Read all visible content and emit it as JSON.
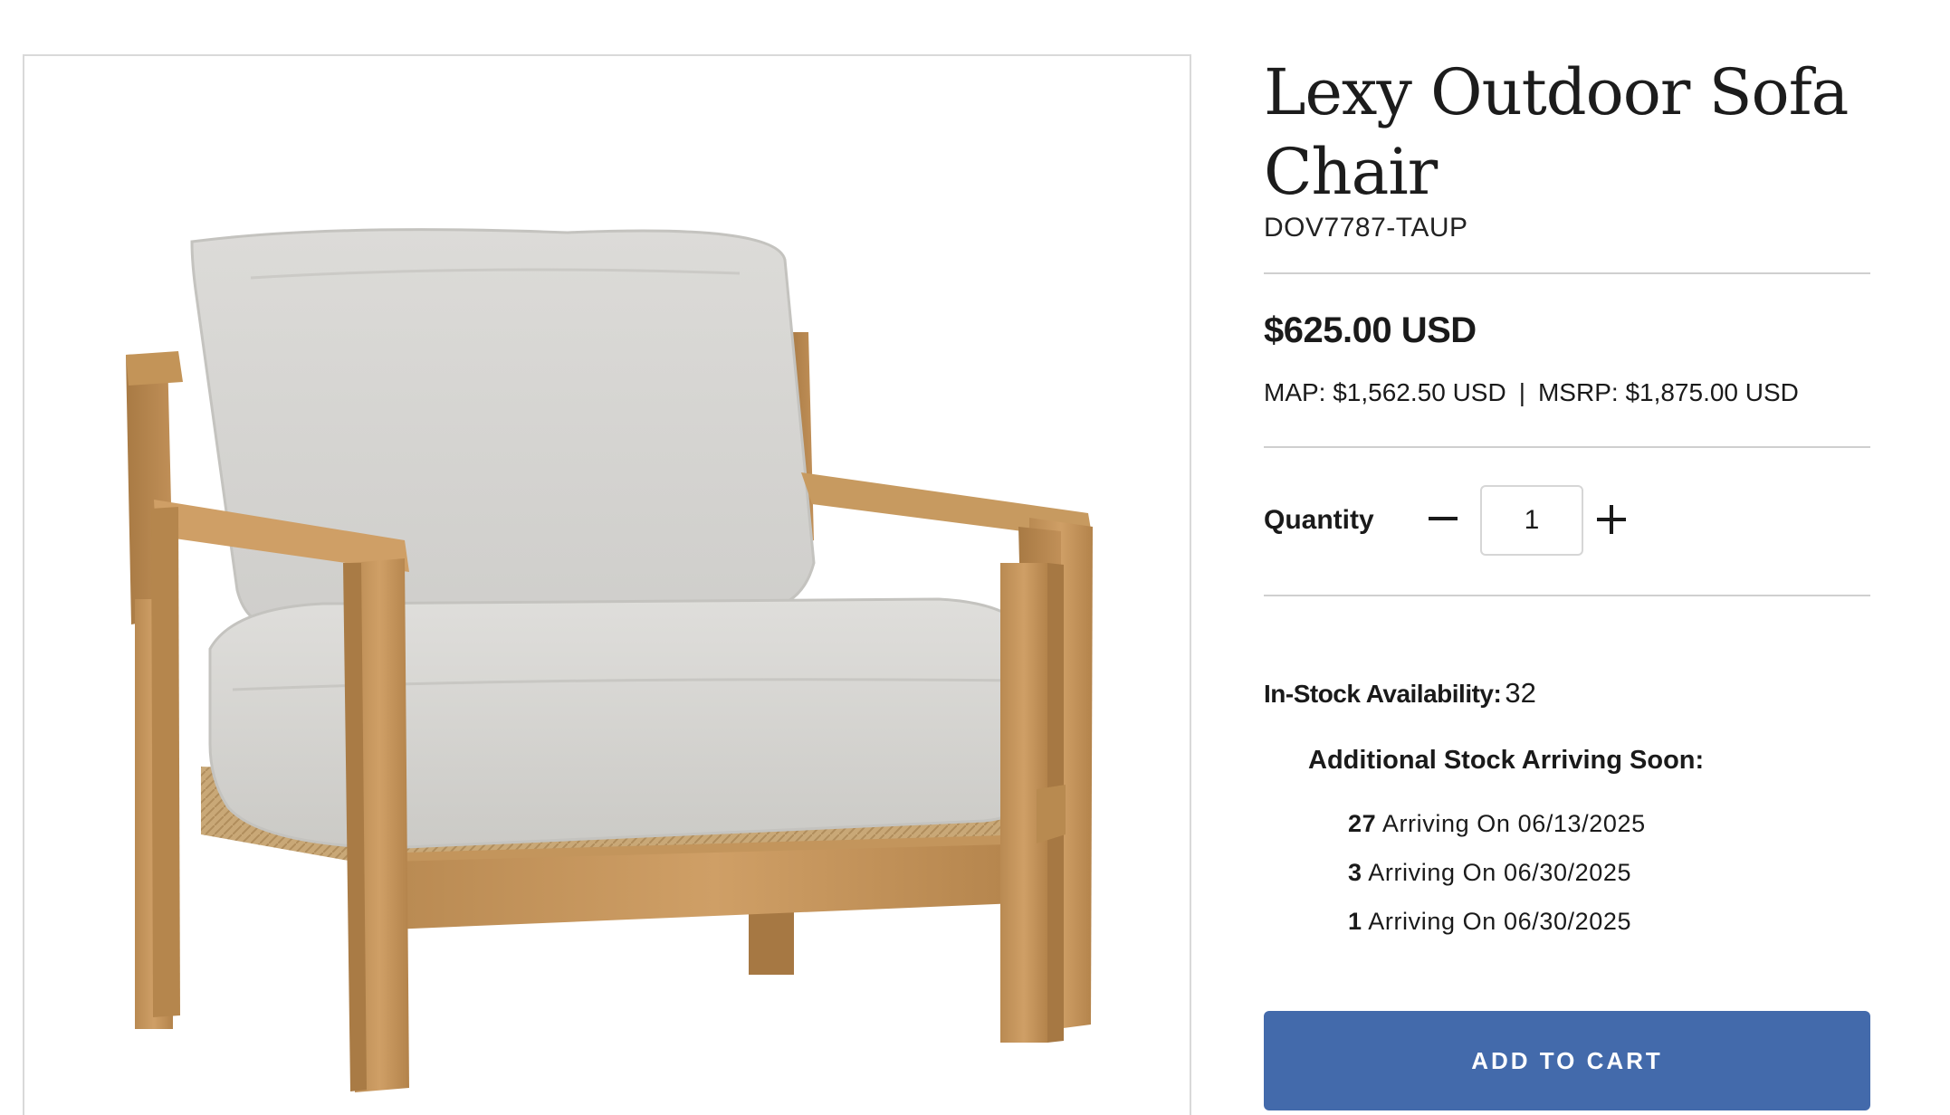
{
  "product": {
    "title": "Lexy Outdoor Sofa Chair",
    "sku": "DOV7787-TAUP",
    "price": "$625.00 USD",
    "map": "MAP: $1,562.50 USD",
    "msrp": "MSRP: $1,875.00 USD",
    "separator": "|",
    "image_subject": "teak armchair with light grey cushions"
  },
  "quantity": {
    "label": "Quantity",
    "value": "1",
    "decrement_icon": "minus-icon",
    "increment_icon": "plus-icon"
  },
  "stock": {
    "label": "In-Stock Availability:",
    "value": "32",
    "arriving_heading": "Additional Stock Arriving Soon:",
    "arrivals": [
      {
        "count": "27",
        "text": "Arriving On 06/13/2025"
      },
      {
        "count": "3",
        "text": "Arriving On 06/30/2025"
      },
      {
        "count": "1",
        "text": "Arriving On 06/30/2025"
      }
    ]
  },
  "cart": {
    "button_label": "ADD TO CART"
  },
  "colors": {
    "accent": "#436aab",
    "divider": "#cfcfcf",
    "text": "#1a1a1a"
  }
}
